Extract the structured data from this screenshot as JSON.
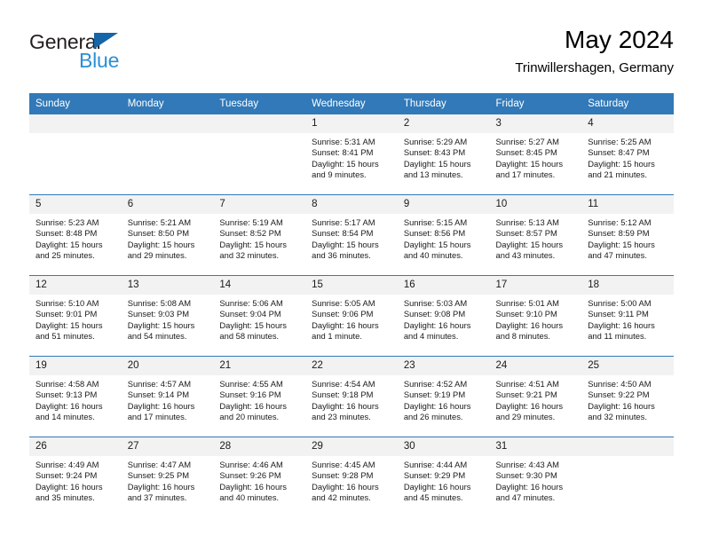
{
  "brand": {
    "name_part1": "General",
    "name_part2": "Blue",
    "colors": {
      "dark": "#231f20",
      "blue": "#2b8fd6",
      "triangle": "#1565a8"
    }
  },
  "header": {
    "title": "May 2024",
    "subtitle": "Trinwillershagen, Germany"
  },
  "theme": {
    "header_blue": "#3179b8",
    "daynum_bg": "#f2f2f2",
    "row_divider": "#3179b8"
  },
  "weekdays": [
    "Sunday",
    "Monday",
    "Tuesday",
    "Wednesday",
    "Thursday",
    "Friday",
    "Saturday"
  ],
  "weeks": [
    [
      {
        "day": "",
        "empty": true
      },
      {
        "day": "",
        "empty": true
      },
      {
        "day": "",
        "empty": true
      },
      {
        "day": "1",
        "sunrise": "Sunrise: 5:31 AM",
        "sunset": "Sunset: 8:41 PM",
        "daylight": "Daylight: 15 hours and 9 minutes."
      },
      {
        "day": "2",
        "sunrise": "Sunrise: 5:29 AM",
        "sunset": "Sunset: 8:43 PM",
        "daylight": "Daylight: 15 hours and 13 minutes."
      },
      {
        "day": "3",
        "sunrise": "Sunrise: 5:27 AM",
        "sunset": "Sunset: 8:45 PM",
        "daylight": "Daylight: 15 hours and 17 minutes."
      },
      {
        "day": "4",
        "sunrise": "Sunrise: 5:25 AM",
        "sunset": "Sunset: 8:47 PM",
        "daylight": "Daylight: 15 hours and 21 minutes."
      }
    ],
    [
      {
        "day": "5",
        "sunrise": "Sunrise: 5:23 AM",
        "sunset": "Sunset: 8:48 PM",
        "daylight": "Daylight: 15 hours and 25 minutes."
      },
      {
        "day": "6",
        "sunrise": "Sunrise: 5:21 AM",
        "sunset": "Sunset: 8:50 PM",
        "daylight": "Daylight: 15 hours and 29 minutes."
      },
      {
        "day": "7",
        "sunrise": "Sunrise: 5:19 AM",
        "sunset": "Sunset: 8:52 PM",
        "daylight": "Daylight: 15 hours and 32 minutes."
      },
      {
        "day": "8",
        "sunrise": "Sunrise: 5:17 AM",
        "sunset": "Sunset: 8:54 PM",
        "daylight": "Daylight: 15 hours and 36 minutes."
      },
      {
        "day": "9",
        "sunrise": "Sunrise: 5:15 AM",
        "sunset": "Sunset: 8:56 PM",
        "daylight": "Daylight: 15 hours and 40 minutes."
      },
      {
        "day": "10",
        "sunrise": "Sunrise: 5:13 AM",
        "sunset": "Sunset: 8:57 PM",
        "daylight": "Daylight: 15 hours and 43 minutes."
      },
      {
        "day": "11",
        "sunrise": "Sunrise: 5:12 AM",
        "sunset": "Sunset: 8:59 PM",
        "daylight": "Daylight: 15 hours and 47 minutes."
      }
    ],
    [
      {
        "day": "12",
        "sunrise": "Sunrise: 5:10 AM",
        "sunset": "Sunset: 9:01 PM",
        "daylight": "Daylight: 15 hours and 51 minutes."
      },
      {
        "day": "13",
        "sunrise": "Sunrise: 5:08 AM",
        "sunset": "Sunset: 9:03 PM",
        "daylight": "Daylight: 15 hours and 54 minutes."
      },
      {
        "day": "14",
        "sunrise": "Sunrise: 5:06 AM",
        "sunset": "Sunset: 9:04 PM",
        "daylight": "Daylight: 15 hours and 58 minutes."
      },
      {
        "day": "15",
        "sunrise": "Sunrise: 5:05 AM",
        "sunset": "Sunset: 9:06 PM",
        "daylight": "Daylight: 16 hours and 1 minute."
      },
      {
        "day": "16",
        "sunrise": "Sunrise: 5:03 AM",
        "sunset": "Sunset: 9:08 PM",
        "daylight": "Daylight: 16 hours and 4 minutes."
      },
      {
        "day": "17",
        "sunrise": "Sunrise: 5:01 AM",
        "sunset": "Sunset: 9:10 PM",
        "daylight": "Daylight: 16 hours and 8 minutes."
      },
      {
        "day": "18",
        "sunrise": "Sunrise: 5:00 AM",
        "sunset": "Sunset: 9:11 PM",
        "daylight": "Daylight: 16 hours and 11 minutes."
      }
    ],
    [
      {
        "day": "19",
        "sunrise": "Sunrise: 4:58 AM",
        "sunset": "Sunset: 9:13 PM",
        "daylight": "Daylight: 16 hours and 14 minutes."
      },
      {
        "day": "20",
        "sunrise": "Sunrise: 4:57 AM",
        "sunset": "Sunset: 9:14 PM",
        "daylight": "Daylight: 16 hours and 17 minutes."
      },
      {
        "day": "21",
        "sunrise": "Sunrise: 4:55 AM",
        "sunset": "Sunset: 9:16 PM",
        "daylight": "Daylight: 16 hours and 20 minutes."
      },
      {
        "day": "22",
        "sunrise": "Sunrise: 4:54 AM",
        "sunset": "Sunset: 9:18 PM",
        "daylight": "Daylight: 16 hours and 23 minutes."
      },
      {
        "day": "23",
        "sunrise": "Sunrise: 4:52 AM",
        "sunset": "Sunset: 9:19 PM",
        "daylight": "Daylight: 16 hours and 26 minutes."
      },
      {
        "day": "24",
        "sunrise": "Sunrise: 4:51 AM",
        "sunset": "Sunset: 9:21 PM",
        "daylight": "Daylight: 16 hours and 29 minutes."
      },
      {
        "day": "25",
        "sunrise": "Sunrise: 4:50 AM",
        "sunset": "Sunset: 9:22 PM",
        "daylight": "Daylight: 16 hours and 32 minutes."
      }
    ],
    [
      {
        "day": "26",
        "sunrise": "Sunrise: 4:49 AM",
        "sunset": "Sunset: 9:24 PM",
        "daylight": "Daylight: 16 hours and 35 minutes."
      },
      {
        "day": "27",
        "sunrise": "Sunrise: 4:47 AM",
        "sunset": "Sunset: 9:25 PM",
        "daylight": "Daylight: 16 hours and 37 minutes."
      },
      {
        "day": "28",
        "sunrise": "Sunrise: 4:46 AM",
        "sunset": "Sunset: 9:26 PM",
        "daylight": "Daylight: 16 hours and 40 minutes."
      },
      {
        "day": "29",
        "sunrise": "Sunrise: 4:45 AM",
        "sunset": "Sunset: 9:28 PM",
        "daylight": "Daylight: 16 hours and 42 minutes."
      },
      {
        "day": "30",
        "sunrise": "Sunrise: 4:44 AM",
        "sunset": "Sunset: 9:29 PM",
        "daylight": "Daylight: 16 hours and 45 minutes."
      },
      {
        "day": "31",
        "sunrise": "Sunrise: 4:43 AM",
        "sunset": "Sunset: 9:30 PM",
        "daylight": "Daylight: 16 hours and 47 minutes."
      },
      {
        "day": "",
        "empty": true
      }
    ]
  ]
}
